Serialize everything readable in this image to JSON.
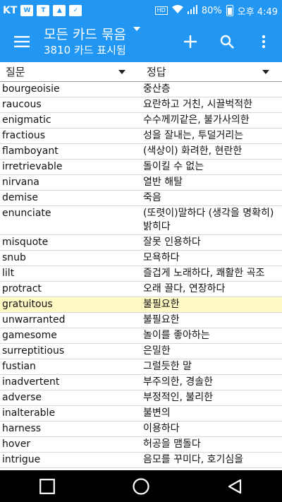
{
  "status_bar": {
    "carrier": "KT",
    "hd": "HD",
    "battery": "80%",
    "time": "오후 4:49"
  },
  "app_bar": {
    "title": "모든 카드 묶음",
    "subtitle": "3810 카드 표시됨"
  },
  "columns": {
    "question": "질문",
    "answer": "정답"
  },
  "rows": [
    {
      "q": "bourgeoisie",
      "a": "중산층"
    },
    {
      "q": "raucous",
      "a": "요란하고 거친, 시끌벅적한"
    },
    {
      "q": "enigmatic",
      "a": "수수께끼같은, 불가사의한"
    },
    {
      "q": "fractious",
      "a": "성을 잘내는, 투덜거리는"
    },
    {
      "q": "flamboyant",
      "a": "(색상이) 화려한, 현란한"
    },
    {
      "q": "irretrievable",
      "a": "돌이킬 수 없는"
    },
    {
      "q": "nirvana",
      "a": "열반 해탈"
    },
    {
      "q": "demise",
      "a": "죽음"
    },
    {
      "q": "enunciate",
      "a": "(또렷이)말하다 (생각을 명확히) 밝히다"
    },
    {
      "q": "misquote",
      "a": "잘못 인용하다"
    },
    {
      "q": "snub",
      "a": "모욕하다"
    },
    {
      "q": "lilt",
      "a": "즐겁게 노래하다, 쾌활한 곡조"
    },
    {
      "q": "protract",
      "a": "오래 끌다, 연장하다"
    },
    {
      "q": "gratuitous",
      "a": "불필요한"
    },
    {
      "q": "unwarranted",
      "a": "불필요한"
    },
    {
      "q": "gamesome",
      "a": "놀이를 좋아하는"
    },
    {
      "q": "surreptitious",
      "a": "은밀한"
    },
    {
      "q": "fustian",
      "a": "그럴듯한 말"
    },
    {
      "q": "inadvertent",
      "a": "부주의한, 경솔한"
    },
    {
      "q": "adverse",
      "a": "부정적인, 불리한"
    },
    {
      "q": "inalterable",
      "a": "불변의"
    },
    {
      "q": "harness",
      "a": "이용하다"
    },
    {
      "q": "hover",
      "a": "허공을 맴돌다"
    },
    {
      "q": "intrigue",
      "a": "음모를 꾸미다, 호기심을"
    }
  ],
  "highlighted_row": "gratuitous",
  "colors": {
    "primary": "#2196f3",
    "highlight": "#fff9c4"
  }
}
